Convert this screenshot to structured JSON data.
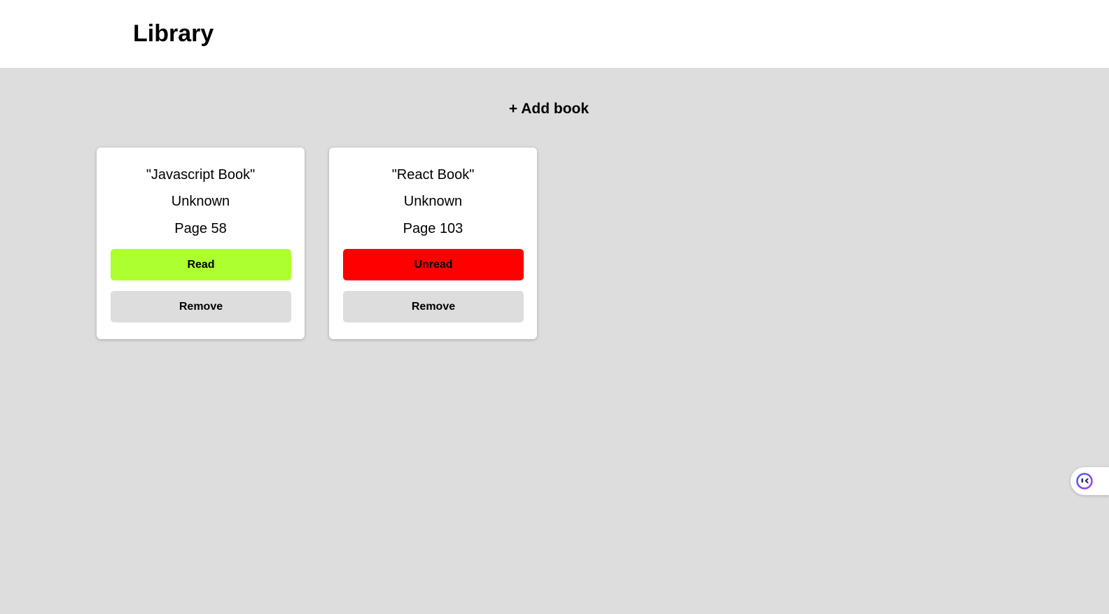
{
  "header": {
    "title": "Library"
  },
  "actions": {
    "add_book_label": "+ Add book"
  },
  "books": [
    {
      "title": "\"Javascript Book\"",
      "author": "Unknown",
      "pages": "Page 58",
      "status_label": "Read",
      "status_color": "#adff2f",
      "remove_label": "Remove"
    },
    {
      "title": "\"React Book\"",
      "author": "Unknown",
      "pages": "Page 103",
      "status_label": "Unread",
      "status_color": "#ff0000",
      "remove_label": "Remove"
    }
  ],
  "widget": {
    "icon": "assistant-face-icon"
  }
}
